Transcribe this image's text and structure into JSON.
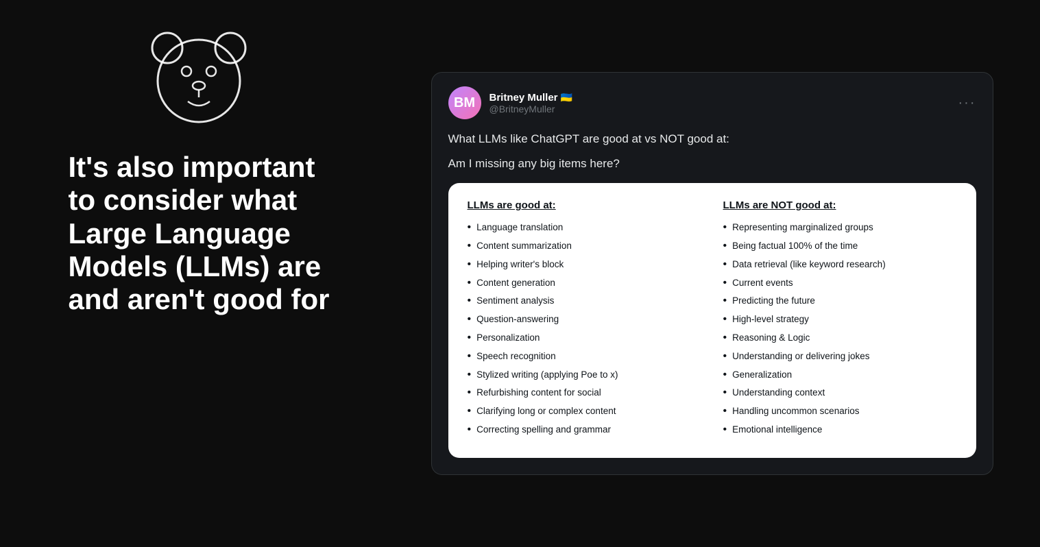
{
  "left": {
    "heading_line1": "It's also important",
    "heading_line2": "to consider what",
    "heading_line3": "Large Language",
    "heading_line4": "Models (LLMs) are",
    "heading_line5": "and aren't good for"
  },
  "tweet": {
    "user_name": "Britney Muller",
    "user_flag": "🇺🇦",
    "user_handle": "@BritneyMuller",
    "more_label": "···",
    "text_line1": "What LLMs like ChatGPT are good at vs NOT good at:",
    "text_line2": "Am I missing any big items here?",
    "good_title": "LLMs are good at:",
    "good_items": [
      "Language translation",
      "Content summarization",
      "Helping writer's block",
      "Content generation",
      "Sentiment analysis",
      "Question-answering",
      "Personalization",
      "Speech recognition",
      "Stylized writing (applying Poe to x)",
      "Refurbishing content for social",
      "Clarifying long or complex content",
      "Correcting spelling and grammar"
    ],
    "not_good_title": "LLMs are NOT good at:",
    "not_good_items": [
      "Representing marginalized groups",
      "Being factual 100% of the time",
      "Data retrieval (like keyword research)",
      "Current events",
      "Predicting the future",
      "High-level strategy",
      "Reasoning & Logic",
      "Understanding or delivering jokes",
      "Generalization",
      "Understanding context",
      "Handling uncommon scenarios",
      "Emotional intelligence"
    ]
  }
}
